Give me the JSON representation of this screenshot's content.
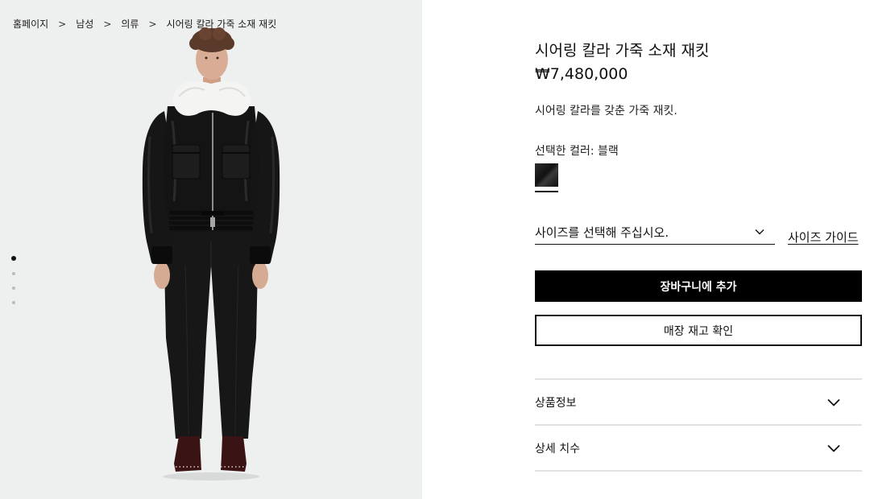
{
  "breadcrumb": {
    "items": [
      "홈페이지",
      "남성",
      "의류"
    ],
    "current": "시어링 칼라 가죽 소재 재킷",
    "separator": ">"
  },
  "gallery": {
    "dots": 4,
    "active_index": 0
  },
  "product": {
    "title": "시어링 칼라 가죽 소재 재킷",
    "price": "₩7,480,000",
    "description": "시어링 칼라를 갖춘 가죽 재킷.",
    "color_label": "선택한 컬러: 블랙"
  },
  "size": {
    "select_label": "사이즈를 선택해 주십시오.",
    "guide_label": "사이즈 가이드"
  },
  "actions": {
    "add_to_cart": "장바구니에 추가",
    "store_stock": "매장 재고 확인"
  },
  "accordion": {
    "items": [
      {
        "label": "상품정보"
      },
      {
        "label": "상세 치수"
      }
    ]
  },
  "colors": {
    "image_bg": "#eef0ef",
    "button_primary": "#000000",
    "text": "#111111"
  }
}
